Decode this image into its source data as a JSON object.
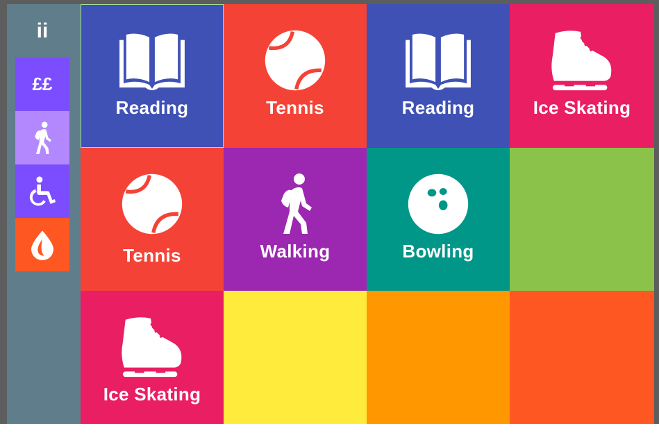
{
  "sidebar": {
    "top_label": "ii",
    "buttons": [
      {
        "label": "££",
        "icon": "pound-icon",
        "color": "#7c4dff"
      },
      {
        "icon": "hiker-icon",
        "color": "#b388ff"
      },
      {
        "icon": "wheelchair-icon",
        "color": "#7c4dff"
      },
      {
        "icon": "water-drop-icon",
        "color": "#ff5722"
      }
    ]
  },
  "tiles": [
    {
      "label": "Reading",
      "icon": "book-icon",
      "color": "#3f51b5"
    },
    {
      "label": "Tennis",
      "icon": "tennis-ball-icon",
      "color": "#f44336"
    },
    {
      "label": "Reading",
      "icon": "book-icon",
      "color": "#3f51b5"
    },
    {
      "label": "Ice Skating",
      "icon": "ice-skate-icon",
      "color": "#e91e63"
    },
    {
      "label": "Tennis",
      "icon": "tennis-ball-icon",
      "color": "#f44336"
    },
    {
      "label": "Walking",
      "icon": "hiker-icon",
      "color": "#9c27b0"
    },
    {
      "label": "Bowling",
      "icon": "bowling-ball-icon",
      "color": "#009688"
    },
    {
      "label": "",
      "color": "#8bc34a"
    },
    {
      "label": "Ice Skating",
      "icon": "ice-skate-icon",
      "color": "#e91e63"
    },
    {
      "label": "",
      "color": "#ffeb3b"
    },
    {
      "label": "",
      "color": "#ff9800"
    },
    {
      "label": "",
      "color": "#ff5722"
    }
  ]
}
